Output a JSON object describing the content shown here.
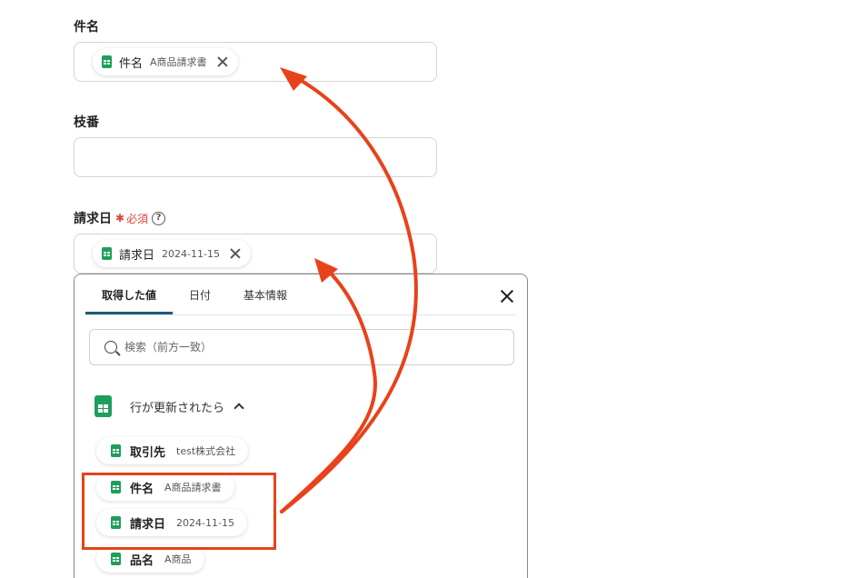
{
  "fields": {
    "subject": {
      "label": "件名",
      "chip_name": "件名",
      "chip_value": "A商品請求書"
    },
    "branch": {
      "label": "枝番",
      "value": ""
    },
    "invoice_date": {
      "label": "請求日",
      "required_star": "✱",
      "required_text": "必須",
      "help": "?",
      "chip_name": "請求日",
      "chip_value": "2024-11-15"
    }
  },
  "panel": {
    "tabs": [
      "取得した値",
      "日付",
      "基本情報"
    ],
    "active_tab": "取得した値",
    "search_placeholder": "検索（前方一致）",
    "group_title": "行が更新されたら",
    "items": [
      {
        "name": "取引先",
        "value": "test株式会社"
      },
      {
        "name": "件名",
        "value": "A商品請求書"
      },
      {
        "name": "請求日",
        "value": "2024-11-15"
      },
      {
        "name": "品名",
        "value": "A商品"
      }
    ]
  },
  "colors": {
    "accent_arrow": "#e8421a",
    "sheet_green": "#1e9e5b",
    "required": "#e0433a",
    "tab_underline": "#1f5a7a"
  },
  "icons": [
    "spreadsheet-icon",
    "close-icon",
    "search-icon",
    "chevron-up-icon",
    "help-icon",
    "required-asterisk-icon"
  ]
}
